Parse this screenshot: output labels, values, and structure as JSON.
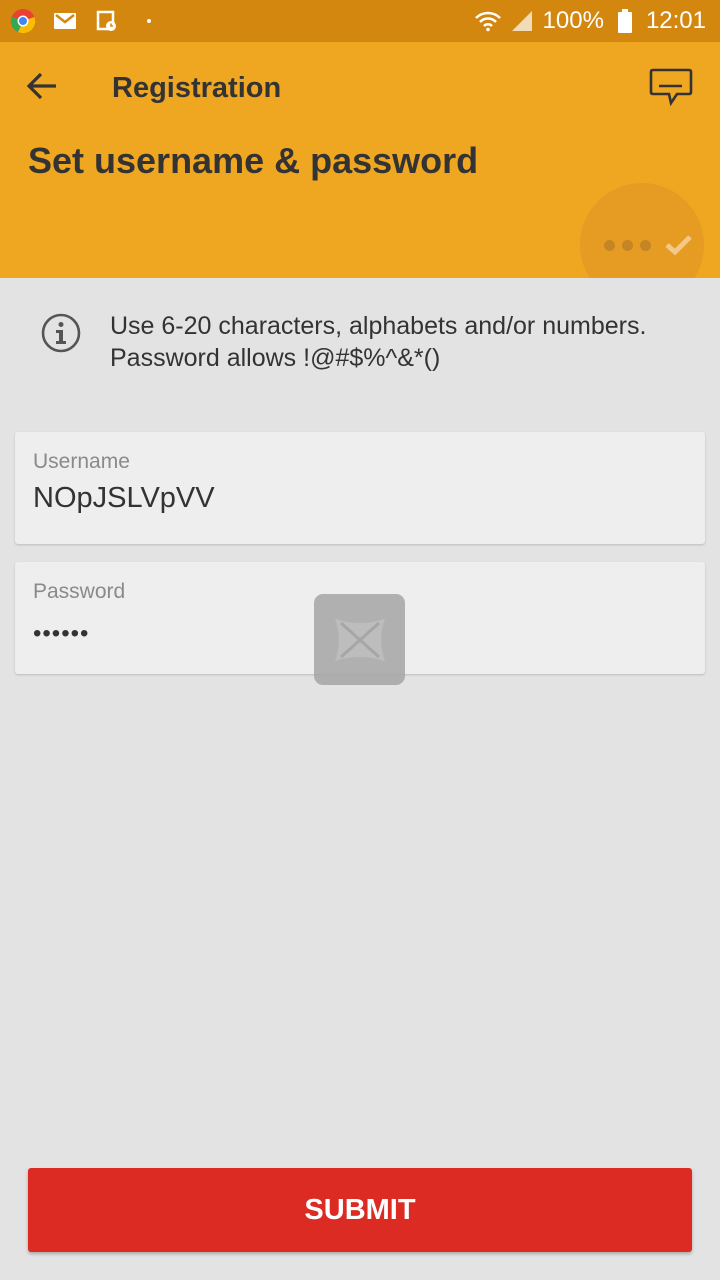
{
  "status_bar": {
    "battery_percent": "100%",
    "time": "12:01",
    "icons": [
      "chrome-icon",
      "gmail-icon",
      "calendar-clock-icon",
      "notification-dot-icon",
      "wifi-icon",
      "signal-icon",
      "battery-icon"
    ]
  },
  "header": {
    "title": "Registration",
    "page_title": "Set username & password",
    "color": "#efa621",
    "status_bar_color": "#d4870f"
  },
  "info": {
    "text": "Use 6-20 characters, alphabets and/or numbers. Password allows !@#$%^&*()"
  },
  "form": {
    "username": {
      "label": "Username",
      "value": "NOpJSLVpVV"
    },
    "password": {
      "label": "Password",
      "value": "••••••"
    }
  },
  "submit": {
    "label": "SUBMIT",
    "color": "#db2b22"
  }
}
